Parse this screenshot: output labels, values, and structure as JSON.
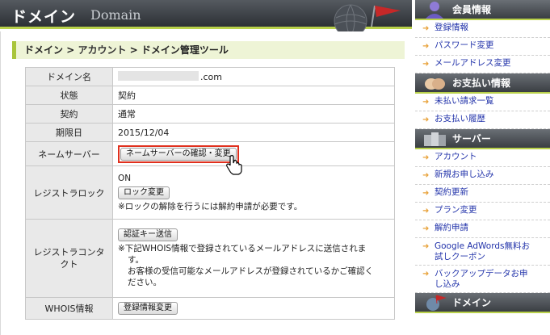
{
  "header": {
    "title_jp": "ドメイン",
    "title_en": "Domain"
  },
  "breadcrumb": {
    "part1": "ドメイン",
    "sep1": " > ",
    "part2": "アカウント",
    "sep2": " > ",
    "part3": "ドメイン管理ツール"
  },
  "table": {
    "domain_label": "ドメイン名",
    "domain_value": ".com",
    "status_label": "状態",
    "status_value": "契約",
    "contract_label": "契約",
    "contract_value": "通常",
    "expiry_label": "期限日",
    "expiry_value": "2015/12/04",
    "nameserver_label": "ネームサーバー",
    "nameserver_button": "ネームサーバーの確認・変更",
    "lock_label": "レジストラロック",
    "lock_status": "ON",
    "lock_button": "ロック変更",
    "lock_note": "※ロックの解除を行うには解約申請が必要です。",
    "contact_label1": "レジストラコンタ",
    "contact_label2": "クト",
    "contact_button": "認証キー送信",
    "contact_note1": "※下記WHOIS情報で登録されているメールアドレスに送信されま",
    "contact_note2": "す。",
    "contact_note3": "お客様の受信可能なメールアドレスが登録されているかご確認く",
    "contact_note4": "ださい。",
    "whois_label": "WHOIS情報",
    "whois_button": "登録情報変更"
  },
  "sidebar": {
    "member": {
      "title": "会員情報",
      "items": [
        "登録情報",
        "パスワード変更",
        "メールアドレス変更"
      ]
    },
    "payment": {
      "title": "お支払い情報",
      "items": [
        "未払い請求一覧",
        "お支払い履歴"
      ]
    },
    "server": {
      "title": "サーバー",
      "items": [
        "アカウント",
        "新規お申し込み",
        "契約更新",
        "プラン変更",
        "解約申請"
      ],
      "adwords_1": "Google AdWords無料お",
      "adwords_2": "試しクーポン",
      "backup_1": "バックアップデータお申",
      "backup_2": "し込み"
    },
    "domain": {
      "title": "ドメイン"
    }
  },
  "colors": {
    "accent_green": "#a9c53b",
    "link_blue": "#2233aa",
    "highlight_red": "#e0301e",
    "arrow_orange": "#e8a23a"
  },
  "icons": {
    "header_decor": [
      "globe-icon",
      "flag-icon"
    ],
    "cursor": "hand-pointer-icon",
    "member": "user-icon",
    "payment": "hands-icon",
    "server": "server-icon",
    "domain": "globe-icon"
  }
}
